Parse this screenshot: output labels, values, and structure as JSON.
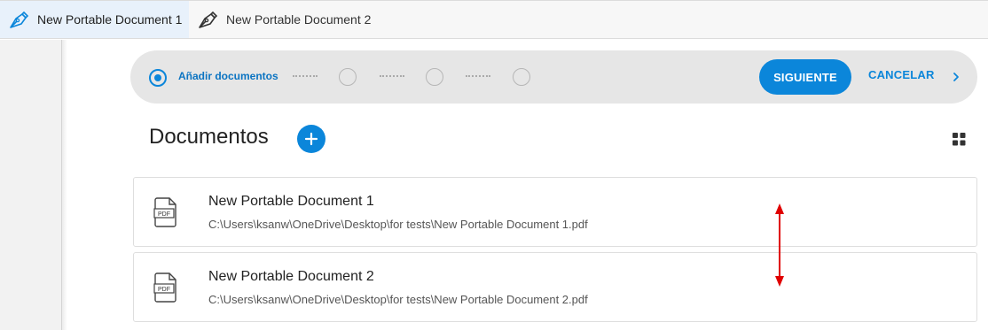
{
  "tabs": [
    {
      "label": "New Portable Document 1",
      "icon": "pen-nib-icon",
      "active": true
    },
    {
      "label": "New Portable Document 2",
      "icon": "pen-nib-icon",
      "active": false
    }
  ],
  "wizard": {
    "active_step_label": "Añadir documentos",
    "next_label": "SIGUIENTE",
    "cancel_label": "CANCELAR"
  },
  "main": {
    "heading": "Documentos"
  },
  "documents": [
    {
      "name": "New Portable Document 1",
      "path": "C:\\Users\\ksanw\\OneDrive\\Desktop\\for tests\\New Portable Document 1.pdf",
      "icon_text": "PDF"
    },
    {
      "name": "New Portable Document 2",
      "path": "C:\\Users\\ksanw\\OneDrive\\Desktop\\for tests\\New Portable Document 2.pdf",
      "icon_text": "PDF"
    }
  ],
  "colors": {
    "accent": "#0b86da",
    "annotation": "#e00000"
  }
}
